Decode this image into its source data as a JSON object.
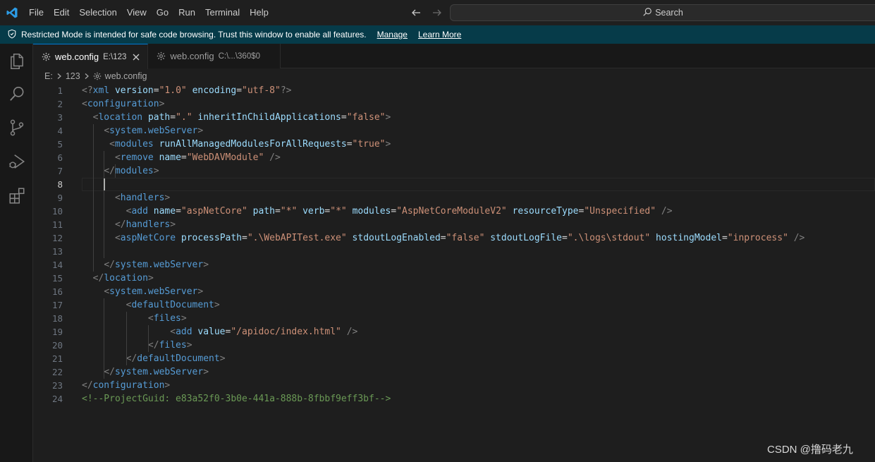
{
  "titlebar": {
    "menu": [
      "File",
      "Edit",
      "Selection",
      "View",
      "Go",
      "Run",
      "Terminal",
      "Help"
    ],
    "search_label": "Search"
  },
  "banner": {
    "message": "Restricted Mode is intended for safe code browsing. Trust this window to enable all features.",
    "manage_label": "Manage",
    "learn_more_label": "Learn More"
  },
  "activity_bar": {
    "icons": [
      "explorer-icon",
      "search-icon",
      "source-control-icon",
      "run-debug-icon",
      "extensions-icon"
    ]
  },
  "tabs": [
    {
      "label": "web.config",
      "description": "E:\\123",
      "active": true
    },
    {
      "label": "web.config",
      "description": "C:\\...\\360$0",
      "active": false
    }
  ],
  "breadcrumb": [
    "E:",
    "123",
    "web.config"
  ],
  "editor": {
    "current_line": 8,
    "lines": [
      {
        "n": "1",
        "code": [
          [
            "br",
            "<?"
          ],
          [
            "tag",
            "xml"
          ],
          [
            "eq",
            " "
          ],
          [
            "attr",
            "version"
          ],
          [
            "eq",
            "="
          ],
          [
            "str",
            "\"1.0\""
          ],
          [
            "eq",
            " "
          ],
          [
            "attr",
            "encoding"
          ],
          [
            "eq",
            "="
          ],
          [
            "str",
            "\"utf-8\""
          ],
          [
            "br",
            "?>"
          ]
        ]
      },
      {
        "n": "2",
        "code": [
          [
            "br",
            "<"
          ],
          [
            "tag",
            "configuration"
          ],
          [
            "br",
            ">"
          ]
        ]
      },
      {
        "n": "3",
        "code": [
          [
            "eq",
            "  "
          ],
          [
            "br",
            "<"
          ],
          [
            "tag",
            "location"
          ],
          [
            "eq",
            " "
          ],
          [
            "attr",
            "path"
          ],
          [
            "eq",
            "="
          ],
          [
            "str",
            "\".\""
          ],
          [
            "eq",
            " "
          ],
          [
            "attr",
            "inheritInChildApplications"
          ],
          [
            "eq",
            "="
          ],
          [
            "str",
            "\"false\""
          ],
          [
            "br",
            ">"
          ]
        ]
      },
      {
        "n": "4",
        "code": [
          [
            "eq",
            "    "
          ],
          [
            "br",
            "<"
          ],
          [
            "tag",
            "system.webServer"
          ],
          [
            "br",
            ">"
          ]
        ]
      },
      {
        "n": "5",
        "code": [
          [
            "eq",
            "     "
          ],
          [
            "br",
            "<"
          ],
          [
            "tag",
            "modules"
          ],
          [
            "eq",
            " "
          ],
          [
            "attr",
            "runAllManagedModulesForAllRequests"
          ],
          [
            "eq",
            "="
          ],
          [
            "str",
            "\"true\""
          ],
          [
            "br",
            ">"
          ]
        ]
      },
      {
        "n": "6",
        "code": [
          [
            "eq",
            "      "
          ],
          [
            "br",
            "<"
          ],
          [
            "tag",
            "remove"
          ],
          [
            "eq",
            " "
          ],
          [
            "attr",
            "name"
          ],
          [
            "eq",
            "="
          ],
          [
            "str",
            "\"WebDAVModule\""
          ],
          [
            "eq",
            " "
          ],
          [
            "br",
            "/>"
          ]
        ]
      },
      {
        "n": "7",
        "code": [
          [
            "eq",
            "    "
          ],
          [
            "br",
            "</"
          ],
          [
            "tag",
            "modules"
          ],
          [
            "br",
            ">"
          ]
        ]
      },
      {
        "n": "8",
        "code": [
          [
            "eq",
            "    "
          ]
        ]
      },
      {
        "n": "9",
        "code": [
          [
            "eq",
            "      "
          ],
          [
            "br",
            "<"
          ],
          [
            "tag",
            "handlers"
          ],
          [
            "br",
            ">"
          ]
        ]
      },
      {
        "n": "10",
        "code": [
          [
            "eq",
            "        "
          ],
          [
            "br",
            "<"
          ],
          [
            "tag",
            "add"
          ],
          [
            "eq",
            " "
          ],
          [
            "attr",
            "name"
          ],
          [
            "eq",
            "="
          ],
          [
            "str",
            "\"aspNetCore\""
          ],
          [
            "eq",
            " "
          ],
          [
            "attr",
            "path"
          ],
          [
            "eq",
            "="
          ],
          [
            "str",
            "\"*\""
          ],
          [
            "eq",
            " "
          ],
          [
            "attr",
            "verb"
          ],
          [
            "eq",
            "="
          ],
          [
            "str",
            "\"*\""
          ],
          [
            "eq",
            " "
          ],
          [
            "attr",
            "modules"
          ],
          [
            "eq",
            "="
          ],
          [
            "str",
            "\"AspNetCoreModuleV2\""
          ],
          [
            "eq",
            " "
          ],
          [
            "attr",
            "resourceType"
          ],
          [
            "eq",
            "="
          ],
          [
            "str",
            "\"Unspecified\""
          ],
          [
            "eq",
            " "
          ],
          [
            "br",
            "/>"
          ]
        ]
      },
      {
        "n": "11",
        "code": [
          [
            "eq",
            "      "
          ],
          [
            "br",
            "</"
          ],
          [
            "tag",
            "handlers"
          ],
          [
            "br",
            ">"
          ]
        ]
      },
      {
        "n": "12",
        "code": [
          [
            "eq",
            "      "
          ],
          [
            "br",
            "<"
          ],
          [
            "tag",
            "aspNetCore"
          ],
          [
            "eq",
            " "
          ],
          [
            "attr",
            "processPath"
          ],
          [
            "eq",
            "="
          ],
          [
            "str",
            "\".\\WebAPITest.exe\""
          ],
          [
            "eq",
            " "
          ],
          [
            "attr",
            "stdoutLogEnabled"
          ],
          [
            "eq",
            "="
          ],
          [
            "str",
            "\"false\""
          ],
          [
            "eq",
            " "
          ],
          [
            "attr",
            "stdoutLogFile"
          ],
          [
            "eq",
            "="
          ],
          [
            "str",
            "\".\\logs\\stdout\""
          ],
          [
            "eq",
            " "
          ],
          [
            "attr",
            "hostingModel"
          ],
          [
            "eq",
            "="
          ],
          [
            "str",
            "\"inprocess\""
          ],
          [
            "eq",
            " "
          ],
          [
            "br",
            "/>"
          ]
        ]
      },
      {
        "n": "13",
        "code": [
          [
            "eq",
            ""
          ]
        ]
      },
      {
        "n": "14",
        "code": [
          [
            "eq",
            "    "
          ],
          [
            "br",
            "</"
          ],
          [
            "tag",
            "system.webServer"
          ],
          [
            "br",
            ">"
          ]
        ]
      },
      {
        "n": "15",
        "code": [
          [
            "eq",
            "  "
          ],
          [
            "br",
            "</"
          ],
          [
            "tag",
            "location"
          ],
          [
            "br",
            ">"
          ]
        ]
      },
      {
        "n": "16",
        "code": [
          [
            "eq",
            "    "
          ],
          [
            "br",
            "<"
          ],
          [
            "tag",
            "system.webServer"
          ],
          [
            "br",
            ">"
          ]
        ]
      },
      {
        "n": "17",
        "code": [
          [
            "eq",
            "        "
          ],
          [
            "br",
            "<"
          ],
          [
            "tag",
            "defaultDocument"
          ],
          [
            "br",
            ">"
          ]
        ]
      },
      {
        "n": "18",
        "code": [
          [
            "eq",
            "            "
          ],
          [
            "br",
            "<"
          ],
          [
            "tag",
            "files"
          ],
          [
            "br",
            ">"
          ]
        ]
      },
      {
        "n": "19",
        "code": [
          [
            "eq",
            "                "
          ],
          [
            "br",
            "<"
          ],
          [
            "tag",
            "add"
          ],
          [
            "eq",
            " "
          ],
          [
            "attr",
            "value"
          ],
          [
            "eq",
            "="
          ],
          [
            "str",
            "\"/apidoc/index.html\""
          ],
          [
            "eq",
            " "
          ],
          [
            "br",
            "/>"
          ]
        ]
      },
      {
        "n": "20",
        "code": [
          [
            "eq",
            "            "
          ],
          [
            "br",
            "</"
          ],
          [
            "tag",
            "files"
          ],
          [
            "br",
            ">"
          ]
        ]
      },
      {
        "n": "21",
        "code": [
          [
            "eq",
            "        "
          ],
          [
            "br",
            "</"
          ],
          [
            "tag",
            "defaultDocument"
          ],
          [
            "br",
            ">"
          ]
        ]
      },
      {
        "n": "22",
        "code": [
          [
            "eq",
            "    "
          ],
          [
            "br",
            "</"
          ],
          [
            "tag",
            "system.webServer"
          ],
          [
            "br",
            ">"
          ]
        ]
      },
      {
        "n": "23",
        "code": [
          [
            "br",
            "</"
          ],
          [
            "tag",
            "configuration"
          ],
          [
            "br",
            ">"
          ]
        ]
      },
      {
        "n": "24",
        "code": [
          [
            "com",
            "<!--ProjectGuid: e83a52f0-3b0e-441a-888b-8fbbf9eff3bf-->"
          ]
        ]
      }
    ]
  },
  "watermark": "CSDN @撸码老九",
  "colors": {
    "banner_bg": "#063b49",
    "tag": "#569cd6",
    "attr": "#9cdcfe",
    "string": "#ce9178",
    "comment": "#6a9955",
    "bracket": "#808080"
  }
}
